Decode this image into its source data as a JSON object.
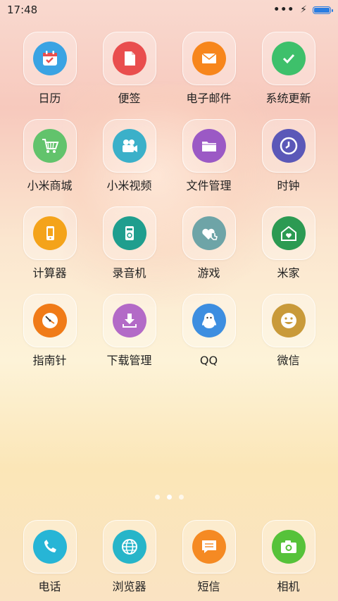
{
  "status": {
    "time": "17:48",
    "battery_level": 1.0
  },
  "apps": [
    {
      "label": "日历",
      "icon": "calendar-icon",
      "color": "#3aa3e3",
      "name": "app-calendar"
    },
    {
      "label": "便签",
      "icon": "note-icon",
      "color": "#e94e4e",
      "name": "app-notes"
    },
    {
      "label": "电子邮件",
      "icon": "mail-icon",
      "color": "#f7861c",
      "name": "app-email"
    },
    {
      "label": "系统更新",
      "icon": "check-icon",
      "color": "#3ec06b",
      "name": "app-system-update"
    },
    {
      "label": "小米商城",
      "icon": "cart-icon",
      "color": "#62c36c",
      "name": "app-mi-store"
    },
    {
      "label": "小米视频",
      "icon": "video-icon",
      "color": "#3bb0c9",
      "name": "app-mi-video"
    },
    {
      "label": "文件管理",
      "icon": "folder-icon",
      "color": "#9b59c5",
      "name": "app-file-manager"
    },
    {
      "label": "时钟",
      "icon": "clock-icon",
      "color": "#5b58b8",
      "name": "app-clock"
    },
    {
      "label": "计算器",
      "icon": "calculator-icon",
      "color": "#f4a31a",
      "name": "app-calculator"
    },
    {
      "label": "录音机",
      "icon": "recorder-icon",
      "color": "#1f9e8e",
      "name": "app-recorder"
    },
    {
      "label": "游戏",
      "icon": "game-icon",
      "color": "#6ea4a7",
      "name": "app-games"
    },
    {
      "label": "米家",
      "icon": "home-icon",
      "color": "#2c9a52",
      "name": "app-mijia"
    },
    {
      "label": "指南针",
      "icon": "compass-icon",
      "color": "#f07b18",
      "name": "app-compass"
    },
    {
      "label": "下载管理",
      "icon": "download-icon",
      "color": "#b36ac7",
      "name": "app-downloads"
    },
    {
      "label": "QQ",
      "icon": "qq-icon",
      "color": "#3d8ee0",
      "name": "app-qq"
    },
    {
      "label": "微信",
      "icon": "smile-icon",
      "color": "#c99a3a",
      "name": "app-wechat"
    }
  ],
  "dock": [
    {
      "label": "电话",
      "icon": "phone-icon",
      "color": "#27b5d6",
      "name": "dock-phone"
    },
    {
      "label": "浏览器",
      "icon": "globe-icon",
      "color": "#27b5c9",
      "name": "dock-browser"
    },
    {
      "label": "短信",
      "icon": "message-icon",
      "color": "#f58a23",
      "name": "dock-messages"
    },
    {
      "label": "相机",
      "icon": "camera-icon",
      "color": "#56c23a",
      "name": "dock-camera"
    }
  ],
  "pager": {
    "pages": 3,
    "active": 1
  }
}
